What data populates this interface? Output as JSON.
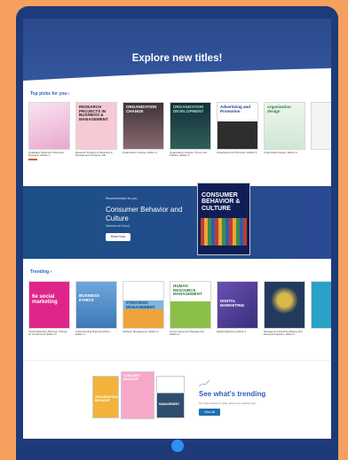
{
  "hero": {
    "title": "Explore new titles!"
  },
  "top_picks": {
    "label": "Top picks for you",
    "books": [
      {
        "cover_title": "",
        "caption": "Qualitative Methods in Business Research, Edition 2",
        "color": "#f3d8ea"
      },
      {
        "cover_title": "RESEARCH PROJECTS IN BUSINESS & MANAGEMENT",
        "caption": "Research Projects for Business & Management Students, 3/E",
        "color": "#f6c9d4"
      },
      {
        "cover_title": "ORGANIZATION CHANGE",
        "caption": "Organization Change, Edition 3",
        "color": "#5b4e52"
      },
      {
        "cover_title": "ORGANIZATION DEVELOPMENT",
        "caption": "Organization Change: Theory and Practice, Edition 6",
        "color": "#1c3c44"
      },
      {
        "cover_title": "Advertising and Promotion",
        "caption": "Advertising and Promotion, Edition 5",
        "color": "#ffffff"
      },
      {
        "cover_title": "organization design",
        "caption": "Organization Design, Edition 4",
        "color": "#e9f2ea"
      },
      {
        "cover_title": "",
        "caption": "",
        "color": "#ffffff"
      }
    ]
  },
  "feature": {
    "kicker": "Recommended for you",
    "title": "Consumer Behavior and Culture",
    "author": "Marieke de Mooij",
    "button": "Read Now",
    "cover_title": "CONSUMER BEHAVIOR & CULTURE"
  },
  "trending": {
    "label": "Trending",
    "books": [
      {
        "cover_title": "6e social marketing",
        "caption": "Social Marketing: Behavior Change for Social Good, Edition 6",
        "color": "#e0258a"
      },
      {
        "cover_title": "BUSINESS ETHICS",
        "caption": "Understanding Business Ethics, Edition 4",
        "color": "#5a97d0"
      },
      {
        "cover_title": "STRATEGIC MANAGEMENT",
        "caption": "Strategic Management, Edition 2",
        "color": "#ffffff"
      },
      {
        "cover_title": "HUMAN RESOURCE MANAGEMENT",
        "caption": "Human Resource Management, Edition 5",
        "color": "#8bbf4a"
      },
      {
        "cover_title": "DIGITAL MARKETING",
        "caption": "Digital Marketing, Edition 2",
        "color": "#4b3e8f"
      },
      {
        "cover_title": "",
        "caption": "Management Decision-Making, Big Data and Analytics, Edition 1",
        "color": "#233a5e"
      },
      {
        "cover_title": "",
        "caption": "",
        "color": "#2aa2c8"
      }
    ]
  },
  "trend_promo": {
    "title": "See what's trending",
    "subtitle": "Top titles based on what others are reading now",
    "button": "View All",
    "books": [
      {
        "cover_title": "ORGANIZATIONAL BEHAVIOR",
        "color": "#f2b33a"
      },
      {
        "cover_title": "CONSUMER BEHAVIOR",
        "color": "#f7a8c8"
      },
      {
        "cover_title": "MANAGEMENT",
        "color": "#ffffff"
      }
    ]
  }
}
